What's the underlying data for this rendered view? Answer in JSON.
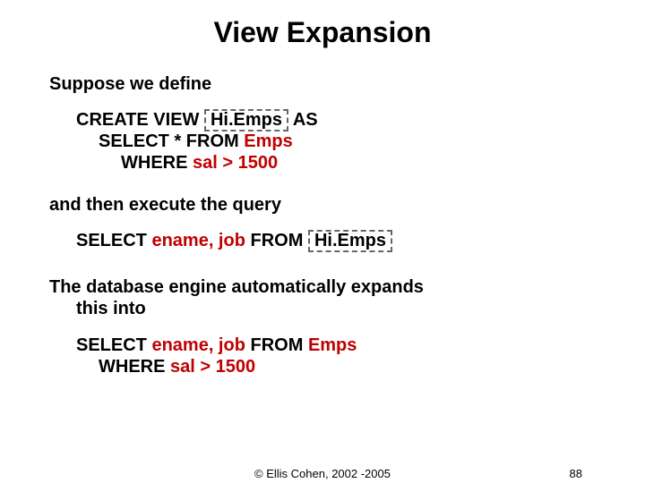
{
  "title": "View Expansion",
  "p1": "Suppose we define",
  "code1": {
    "l1a": "CREATE VIEW ",
    "viewname": "Hi.Emps",
    "l1b": " AS",
    "l2a": "SELECT * FROM ",
    "l2b": "Emps",
    "l3a": "WHERE ",
    "l3b": "sal > 1500"
  },
  "p2": "and then execute the query",
  "query": {
    "a": "SELECT ",
    "b": "ename, job",
    "c": " FROM ",
    "viewref": "Hi.Emps"
  },
  "p3a": "The database engine automatically expands",
  "p3b": "this into",
  "final": {
    "l1a": "SELECT ",
    "l1b": "ename, job",
    "l1c": " FROM ",
    "l1d": "Emps",
    "l2a": "WHERE ",
    "l2b": "sal > 1500"
  },
  "footer": {
    "copyright": "© Ellis Cohen, 2002 -2005",
    "page": "88"
  }
}
